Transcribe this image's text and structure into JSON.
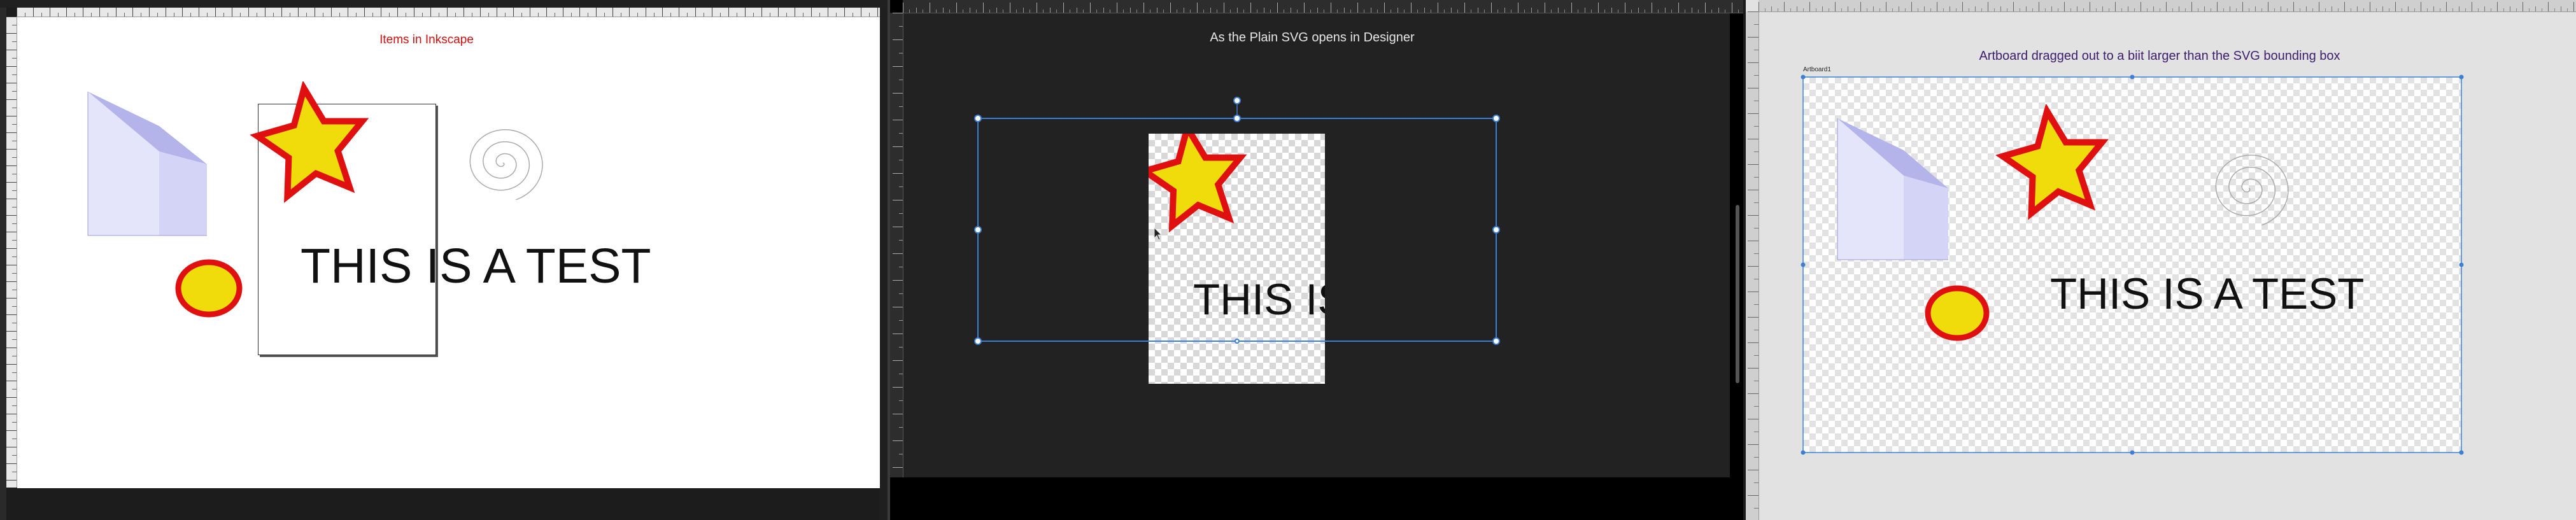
{
  "panels": [
    {
      "caption": "Items in Inkscape",
      "caption_color": "#cc1111",
      "text": "THIS IS A TEST"
    },
    {
      "caption": "As the Plain SVG opens in Designer",
      "caption_color": "#e6e6e6",
      "text": "THIS IS"
    },
    {
      "caption": "Artboard dragged out to a biit larger than the SVG bounding box",
      "caption_color": "#3c1c6b",
      "text": "THIS IS A TEST",
      "artboard_label": "Artboard1"
    }
  ],
  "colors": {
    "star_fill": "#f0dc0a",
    "star_stroke": "#e01010",
    "box_light": "#e4e4fb",
    "box_mid": "#b4b4ea",
    "box_side": "#d4d4f7",
    "selection": "#3d7fd4",
    "designer_bg": "#222222",
    "designer_canvas_bg": "#e2e2e2"
  }
}
